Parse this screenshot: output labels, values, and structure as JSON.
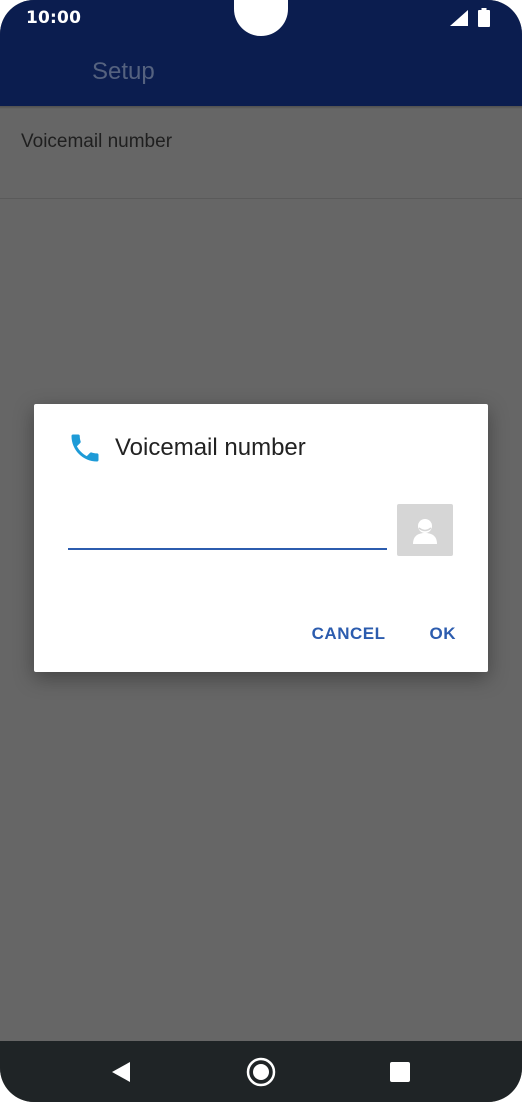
{
  "status_bar": {
    "time": "10:00",
    "icons": [
      "signal-icon",
      "battery-icon"
    ]
  },
  "app_bar": {
    "title": "Setup"
  },
  "preferences": [
    {
      "title": "Voicemail number"
    }
  ],
  "dialog": {
    "icon": "phone-icon",
    "title": "Voicemail number",
    "input_value": "",
    "contact_icon": "contact-picker-icon",
    "cancel_label": "CANCEL",
    "ok_label": "OK"
  },
  "nav_bar": {
    "icons": [
      "back-icon",
      "home-icon",
      "recents-icon"
    ]
  },
  "colors": {
    "app_bar": "#0b1d4f",
    "scrim": "#666666",
    "accent": "#2c5cae",
    "phone_icon": "#1e9bd7",
    "nav_bar": "#1f2426"
  }
}
